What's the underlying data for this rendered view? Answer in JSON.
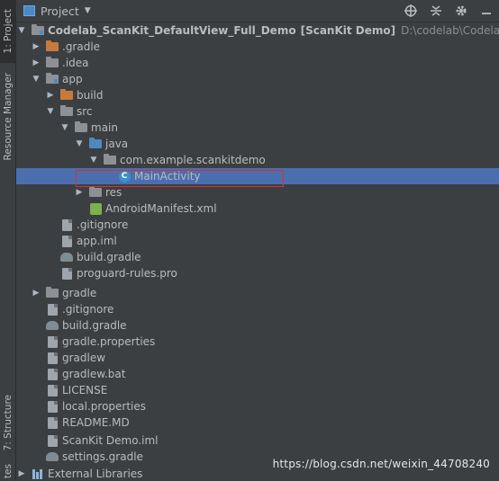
{
  "side_tabs": {
    "project": "1: Project",
    "resource_manager": "Resource Manager",
    "structure": "7: Structure",
    "favorites": "tes"
  },
  "header": {
    "title": "Project",
    "icons": [
      "target-icon",
      "collapse-icon",
      "gear-icon",
      "minimize-icon"
    ]
  },
  "tree": {
    "root": {
      "label": "Codelab_ScanKit_DefaultView_Full_Demo",
      "tag": "[ScanKit Demo]",
      "path": "D:\\codelab\\Codelab_ScanKit_DefaultView"
    },
    "rows": [
      {
        "label": ".gradle"
      },
      {
        "label": ".idea"
      },
      {
        "label": "app"
      },
      {
        "label": "build"
      },
      {
        "label": "src"
      },
      {
        "label": "main"
      },
      {
        "label": "java"
      },
      {
        "label": "com.example.scankitdemo"
      },
      {
        "label": "MainActivity"
      },
      {
        "label": "res"
      },
      {
        "label": "AndroidManifest.xml"
      },
      {
        "label": ".gitignore"
      },
      {
        "label": "app.iml"
      },
      {
        "label": "build.gradle"
      },
      {
        "label": "proguard-rules.pro"
      },
      {
        "label": "gradle"
      },
      {
        "label": ".gitignore"
      },
      {
        "label": "build.gradle"
      },
      {
        "label": "gradle.properties"
      },
      {
        "label": "gradlew"
      },
      {
        "label": "gradlew.bat"
      },
      {
        "label": "LICENSE"
      },
      {
        "label": "local.properties"
      },
      {
        "label": "README.MD"
      },
      {
        "label": "ScanKit Demo.iml"
      },
      {
        "label": "settings.gradle"
      },
      {
        "label": "External Libraries"
      }
    ],
    "selected": "MainActivity"
  },
  "watermark": "https://blog.csdn.net/weixin_44708240"
}
